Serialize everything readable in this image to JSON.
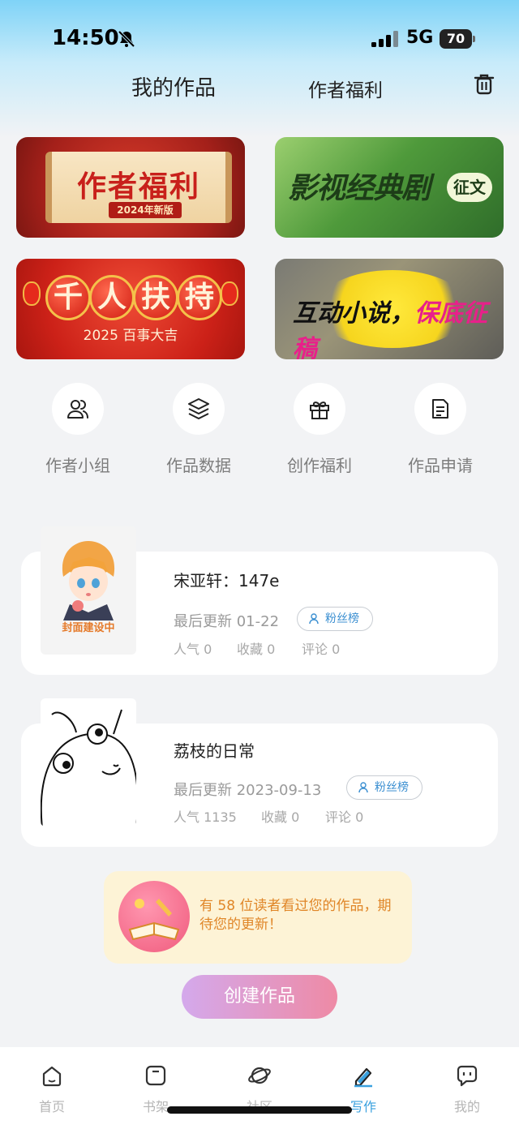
{
  "status": {
    "time": "14:50",
    "network": "5G",
    "battery": "70"
  },
  "header": {
    "tabs": [
      "我的作品",
      "作者福利"
    ]
  },
  "banners": {
    "b1": {
      "title": "作者福利",
      "subtitle": "2024年新版"
    },
    "b2": {
      "title": "影视经典剧",
      "badge": "征文"
    },
    "b3": {
      "chars": [
        "千",
        "人",
        "扶",
        "持"
      ],
      "subtitle": "2025 百事大吉"
    },
    "b4": {
      "title_black": "互动小说，",
      "title_pink": "保底征稿"
    }
  },
  "cover_text": "封面建设中",
  "quick_actions": [
    {
      "label": "作者小组",
      "icon": "group-icon"
    },
    {
      "label": "作品数据",
      "icon": "layers-icon"
    },
    {
      "label": "创作福利",
      "icon": "gift-icon"
    },
    {
      "label": "作品申请",
      "icon": "document-icon"
    }
  ],
  "works": [
    {
      "title": "宋亚轩：147e",
      "update": "最后更新 01-22",
      "fans": "粉丝榜",
      "popularity": "人气 0",
      "favorites": "收藏 0",
      "comments": "评论 0"
    },
    {
      "title": "荔枝的日常",
      "update": "最后更新 2023-09-13",
      "fans": "粉丝榜",
      "popularity": "人气 1135",
      "favorites": "收藏 0",
      "comments": "评论 0"
    }
  ],
  "notice": {
    "text": "有 58 位读者看过您的作品，期待您的更新！"
  },
  "create_button": "创建作品",
  "nav": [
    {
      "label": "首页",
      "icon": "home-icon"
    },
    {
      "label": "书架",
      "icon": "bookshelf-icon"
    },
    {
      "label": "社区",
      "icon": "planet-icon"
    },
    {
      "label": "写作",
      "icon": "pen-icon"
    },
    {
      "label": "我的",
      "icon": "chat-icon"
    }
  ],
  "colors": {
    "accent": "#3aa1df",
    "notice_text": "#e08628"
  }
}
